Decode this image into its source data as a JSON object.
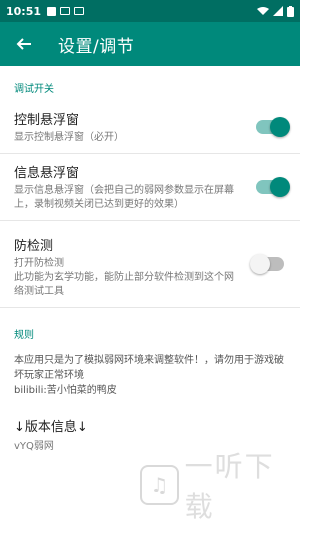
{
  "status": {
    "time": "10:51"
  },
  "appbar": {
    "title": "设置/调节"
  },
  "debug_section": {
    "header": "调试开关",
    "rows": [
      {
        "title": "控制悬浮窗",
        "subtitle": "显示控制悬浮窗（必开）",
        "toggle": "on"
      },
      {
        "title": "信息悬浮窗",
        "subtitle": "显示信息悬浮窗（会把自己的弱网参数显示在屏幕上，录制视频关闭已达到更好的效果）",
        "toggle": "on"
      },
      {
        "title": "防检测",
        "subtitle": "打开防检测\n此功能为玄学功能，能防止部分软件检测到这个网络测试工具",
        "toggle": "off"
      }
    ]
  },
  "rules_section": {
    "header": "规则",
    "text": "本应用只是为了模拟弱网环境来调整软件！，请勿用于游戏破坏玩家正常环境\nbilibili:苦小怕菜的鸭皮"
  },
  "version_section": {
    "title": "↓版本信息↓",
    "subtitle": "vYQ弱网"
  },
  "watermark": {
    "text": "一听下载"
  },
  "colors": {
    "primary": "#00897b",
    "statusbar": "#006e62"
  }
}
